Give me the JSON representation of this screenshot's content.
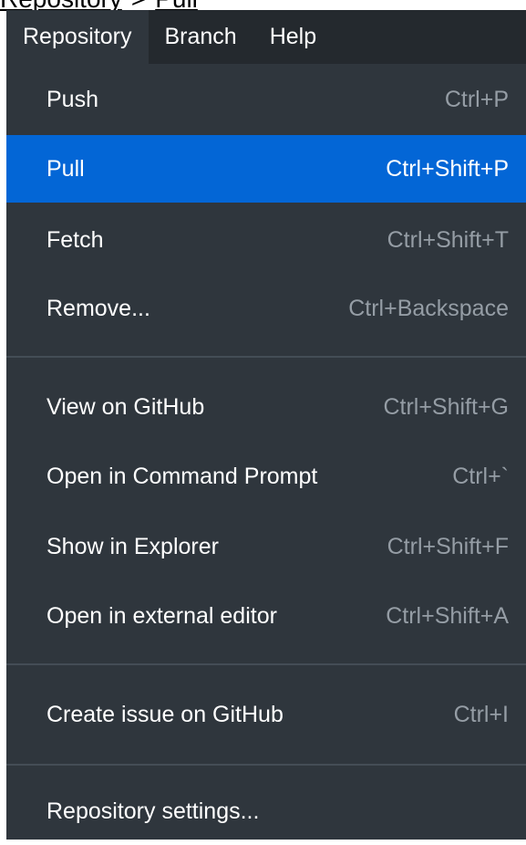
{
  "breadcrumb": {
    "first": "Repository",
    "separator": ">",
    "second": "Pull"
  },
  "menubar": {
    "items": [
      {
        "label": "Repository",
        "active": true
      },
      {
        "label": "Branch",
        "active": false
      },
      {
        "label": "Help",
        "active": false
      }
    ]
  },
  "menu": {
    "items": [
      {
        "label": "Push",
        "shortcut": "Ctrl+P"
      },
      {
        "label": "Pull",
        "shortcut": "Ctrl+Shift+P",
        "highlighted": true
      },
      {
        "label": "Fetch",
        "shortcut": "Ctrl+Shift+T"
      },
      {
        "label": "Remove...",
        "shortcut": "Ctrl+Backspace"
      },
      {
        "label": "View on GitHub",
        "shortcut": "Ctrl+Shift+G"
      },
      {
        "label": "Open in Command Prompt",
        "shortcut": "Ctrl+`"
      },
      {
        "label": "Show in Explorer",
        "shortcut": "Ctrl+Shift+F"
      },
      {
        "label": "Open in external editor",
        "shortcut": "Ctrl+Shift+A"
      },
      {
        "label": "Create issue on GitHub",
        "shortcut": "Ctrl+I"
      },
      {
        "label": "Repository settings...",
        "shortcut": ""
      }
    ]
  },
  "colors": {
    "menubar_bg": "#24292e",
    "menu_bg": "#2f363d",
    "highlight": "#0366d6",
    "shortcut_text": "#959da5",
    "separator": "#444d56"
  }
}
